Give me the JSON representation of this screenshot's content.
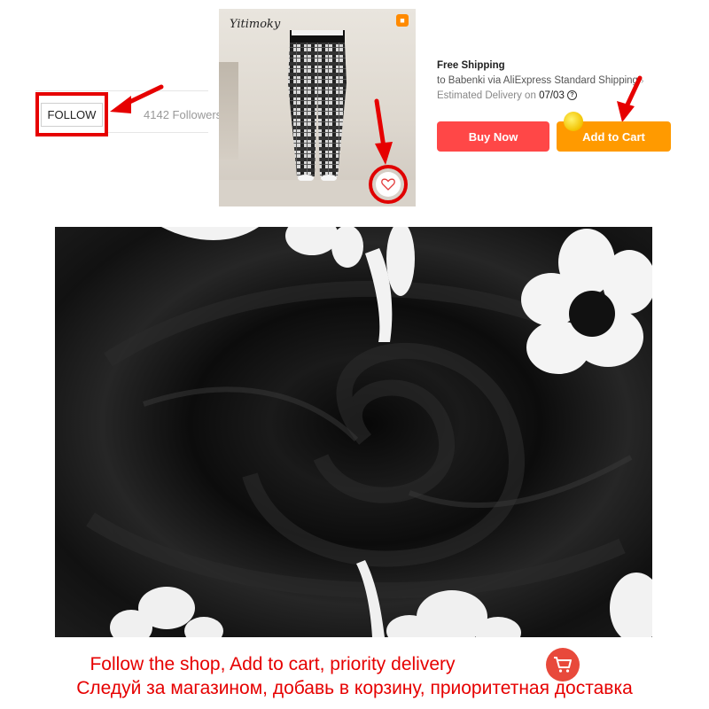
{
  "store": {
    "follow_label": "FOLLOW",
    "followers_text": "4142 Followers"
  },
  "product_photo": {
    "brand_watermark": "Yitimoky",
    "badge_icon": "store-badge-icon",
    "wishlist_icon": "heart-icon"
  },
  "shipping": {
    "title": "Free Shipping",
    "route": "to Babenki via AliExpress Standard Shipping",
    "estimated_label": "Estimated Delivery on",
    "estimated_date": "07/03",
    "info_icon": "question-icon"
  },
  "actions": {
    "buy_now_label": "Buy Now",
    "add_to_cart_label": "Add to Cart"
  },
  "promo": {
    "line_en": "Follow the shop, Add to cart, priority delivery",
    "line_ru": "Следуй за магазином, добавь в корзину, приоритетная доставка",
    "cart_icon": "shopping-cart-icon"
  },
  "colors": {
    "highlight_red": "#e60000",
    "buy_now_bg": "#ff4747",
    "add_to_cart_bg": "#ff9a00",
    "promo_cart_circle": "#e8493b"
  }
}
